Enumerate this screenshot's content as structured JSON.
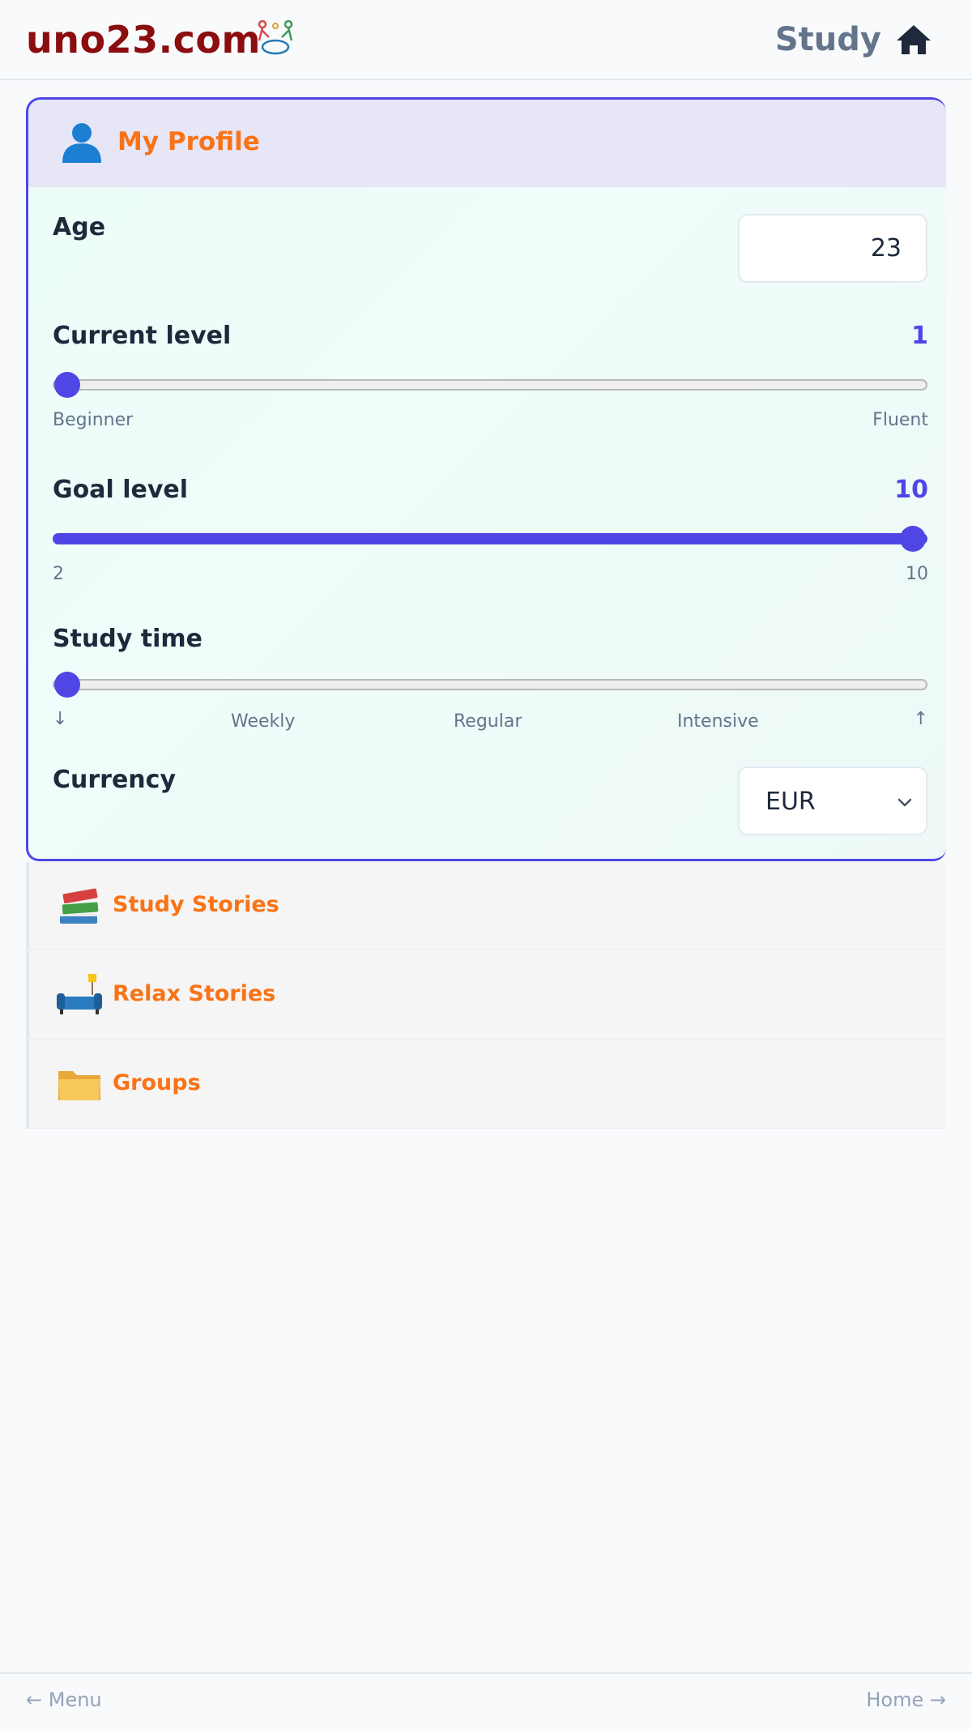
{
  "header": {
    "logo": "uno23.com",
    "title": "Study",
    "home_icon": "home-icon",
    "logo_icon": "people-circle-logo-icon"
  },
  "profile": {
    "icon": "user-silhouette-icon",
    "title": "My Profile",
    "age": {
      "label": "Age",
      "value": "23"
    },
    "current_level": {
      "label": "Current level",
      "value": "1",
      "fraction": 0.0,
      "min_label": "Beginner",
      "max_label": "Fluent"
    },
    "goal_level": {
      "label": "Goal level",
      "value": "10",
      "fraction": 1.0,
      "min_label": "2",
      "max_label": "10"
    },
    "study_time": {
      "label": "Study time",
      "fraction": 0.0,
      "ticks": [
        "↓",
        "Weekly",
        "Regular",
        "Intensive",
        "↑"
      ]
    },
    "currency": {
      "label": "Currency",
      "value": "EUR",
      "icon": "chevron-down-icon"
    }
  },
  "sections": [
    {
      "label": "Study Stories",
      "icon": "books-icon"
    },
    {
      "label": "Relax Stories",
      "icon": "couch-lamp-icon"
    },
    {
      "label": "Groups",
      "icon": "folder-icon"
    }
  ],
  "footer": {
    "left": "← Menu",
    "right": "Home →"
  },
  "colors": {
    "accent": "#4f46e5",
    "section_title": "#f97316",
    "logo": "#8b0d0d"
  }
}
